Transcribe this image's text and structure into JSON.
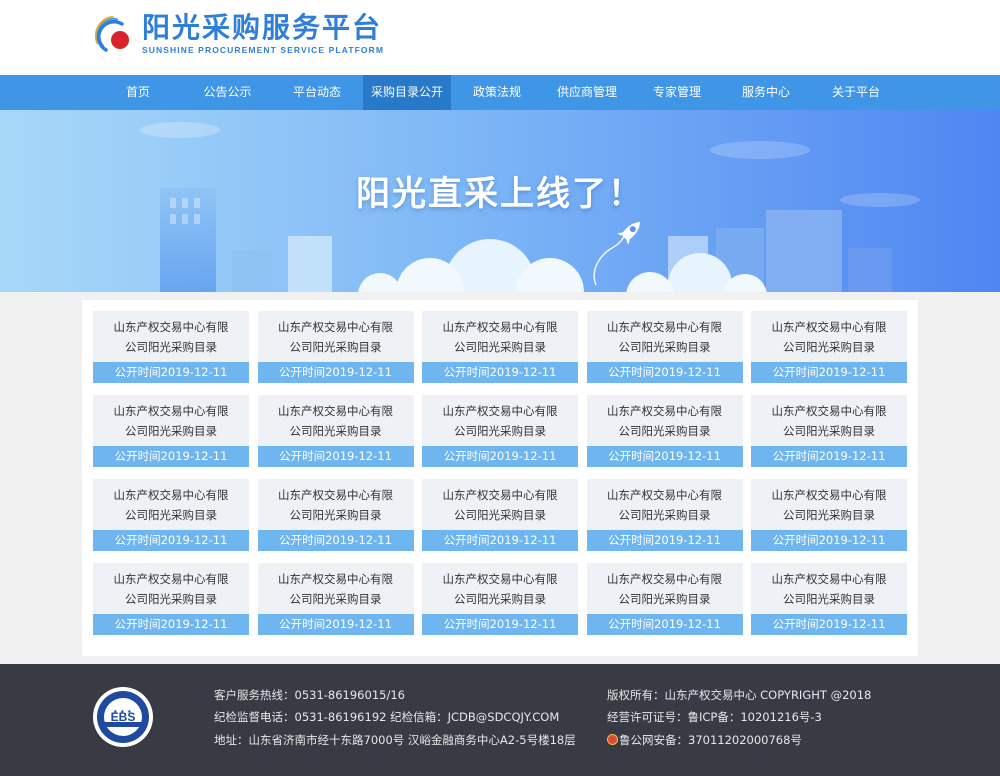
{
  "header": {
    "title": "阳光采购服务平台",
    "subtitle": "SUNSHINE PROCUREMENT SERVICE PLATFORM"
  },
  "nav": {
    "items": [
      {
        "label": "首页"
      },
      {
        "label": "公告公示"
      },
      {
        "label": "平台动态"
      },
      {
        "label": "采购目录公开"
      },
      {
        "label": "政策法规"
      },
      {
        "label": "供应商管理"
      },
      {
        "label": "专家管理"
      },
      {
        "label": "服务中心"
      },
      {
        "label": "关于平台"
      }
    ],
    "active_index": 3
  },
  "banner": {
    "title": "阳光直采上线了！"
  },
  "catalog": {
    "cards": [
      {
        "line1": "山东产权交易中心有限",
        "line2": "公司阳光采购目录",
        "date": "公开时间2019-12-11"
      },
      {
        "line1": "山东产权交易中心有限",
        "line2": "公司阳光采购目录",
        "date": "公开时间2019-12-11"
      },
      {
        "line1": "山东产权交易中心有限",
        "line2": "公司阳光采购目录",
        "date": "公开时间2019-12-11"
      },
      {
        "line1": "山东产权交易中心有限",
        "line2": "公司阳光采购目录",
        "date": "公开时间2019-12-11"
      },
      {
        "line1": "山东产权交易中心有限",
        "line2": "公司阳光采购目录",
        "date": "公开时间2019-12-11"
      },
      {
        "line1": "山东产权交易中心有限",
        "line2": "公司阳光采购目录",
        "date": "公开时间2019-12-11"
      },
      {
        "line1": "山东产权交易中心有限",
        "line2": "公司阳光采购目录",
        "date": "公开时间2019-12-11"
      },
      {
        "line1": "山东产权交易中心有限",
        "line2": "公司阳光采购目录",
        "date": "公开时间2019-12-11"
      },
      {
        "line1": "山东产权交易中心有限",
        "line2": "公司阳光采购目录",
        "date": "公开时间2019-12-11"
      },
      {
        "line1": "山东产权交易中心有限",
        "line2": "公司阳光采购目录",
        "date": "公开时间2019-12-11"
      },
      {
        "line1": "山东产权交易中心有限",
        "line2": "公司阳光采购目录",
        "date": "公开时间2019-12-11"
      },
      {
        "line1": "山东产权交易中心有限",
        "line2": "公司阳光采购目录",
        "date": "公开时间2019-12-11"
      },
      {
        "line1": "山东产权交易中心有限",
        "line2": "公司阳光采购目录",
        "date": "公开时间2019-12-11"
      },
      {
        "line1": "山东产权交易中心有限",
        "line2": "公司阳光采购目录",
        "date": "公开时间2019-12-11"
      },
      {
        "line1": "山东产权交易中心有限",
        "line2": "公司阳光采购目录",
        "date": "公开时间2019-12-11"
      },
      {
        "line1": "山东产权交易中心有限",
        "line2": "公司阳光采购目录",
        "date": "公开时间2019-12-11"
      },
      {
        "line1": "山东产权交易中心有限",
        "line2": "公司阳光采购目录",
        "date": "公开时间2019-12-11"
      },
      {
        "line1": "山东产权交易中心有限",
        "line2": "公司阳光采购目录",
        "date": "公开时间2019-12-11"
      },
      {
        "line1": "山东产权交易中心有限",
        "line2": "公司阳光采购目录",
        "date": "公开时间2019-12-11"
      },
      {
        "line1": "山东产权交易中心有限",
        "line2": "公司阳光采购目录",
        "date": "公开时间2019-12-11"
      }
    ]
  },
  "footer": {
    "logo_text": "EBS",
    "hotline": "客户服务热线：0531-86196015/16",
    "supervision": "纪检监督电话：0531-86196192 纪检信箱：JCDB@SDCQJY.COM",
    "address": "地址：山东省济南市经十东路7000号 汉峪金融商务中心A2-5号楼18层",
    "copyright": "版权所有：山东产权交易中心 COPYRIGHT @2018",
    "icp": "经营许可证号：鲁ICP备：10201216号-3",
    "security": "鲁公网安备：37011202000768号"
  },
  "colors": {
    "primary": "#3f96e6",
    "nav_active": "#2879c9",
    "card_date_bg": "#6fb5ef",
    "footer_bg": "#383a44"
  },
  "icons": [
    "sun-logo-icon",
    "rocket-icon",
    "ebs-seal-icon",
    "police-badge-icon"
  ]
}
